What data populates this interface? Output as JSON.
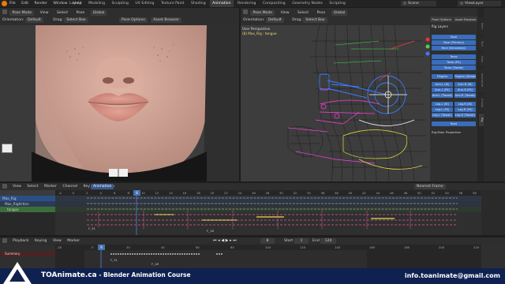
{
  "topbar": {
    "menus": [
      "File",
      "Edit",
      "Render",
      "Window",
      "Help"
    ],
    "workspaces": [
      "Layout",
      "Modeling",
      "Sculpting",
      "UV Editing",
      "Texture Paint",
      "Shading",
      "Animation",
      "Rendering",
      "Compositing",
      "Geometry Nodes",
      "Scripting"
    ],
    "active_workspace": "Animation",
    "scene": "Scene",
    "view_layer": "ViewLayer"
  },
  "left_viewport": {
    "mode": "Pose Mode",
    "view": "View",
    "select": "Select",
    "pose": "Pose",
    "global": "Global",
    "orientation": "Orientation:",
    "default": "Default",
    "drag": "Drag:",
    "select_box": "Select Box",
    "pose_options": "Pose Options",
    "asset_browser": "Asset Browser"
  },
  "right_viewport": {
    "mode": "Pose Mode",
    "view": "View",
    "select": "Select",
    "pose": "Pose",
    "global": "Global",
    "orientation": "Orientation:",
    "default": "Default",
    "drag": "Drag:",
    "select_box": "Select Box",
    "perspective_line1": "User Perspective",
    "perspective_line2": "(8) Max_Rig : tongue",
    "pose_options": "Pose Options",
    "asset_browser": "Asset Browser"
  },
  "rig_panel": {
    "title": "Rig Layers",
    "face": "Face",
    "face_primary": "Face (Primary)",
    "face_secondary": "Face (Secondary)",
    "torso": "Torso",
    "torso_fk": "Torso (FK)",
    "torso_tweak": "Torso (Tweak)",
    "fingers": "Fingers",
    "fingers_detail": "Fingers (Detail)",
    "arm_ik_l": "Arm.L (IK)",
    "arm_ik_r": "Arm.R (IK)",
    "arm_fk_l": "Arm.L (FK)",
    "arm_fk_r": "Arm.R (FK)",
    "arm_tweak_l": "Arm.L (Tweak)",
    "arm_tweak_r": "Arm.R (Tweak)",
    "leg_ik_l": "Leg.L (IK)",
    "leg_ik_r": "Leg.R (IK)",
    "leg_fk_l": "Leg.L (FK)",
    "leg_fk_r": "Leg.R (FK)",
    "leg_tweak_l": "Leg.L (Tweak)",
    "leg_tweak_r": "Leg.R (Tweak)",
    "root": "Root",
    "rig_main_properties": "Rig Main Properties",
    "sidetabs": [
      "Item",
      "Tool",
      "View",
      "Animation",
      "Create",
      "Rig"
    ]
  },
  "dopesheet": {
    "menus": [
      "View",
      "Select",
      "Marker",
      "Channel",
      "Key",
      "Animation"
    ],
    "mode": "Animation",
    "nearest_frame": "Nearest Frame",
    "channels": [
      "Max_Rig",
      "Max_RigAction",
      "tongue"
    ],
    "frames": [
      "-4",
      "0",
      "2",
      "4",
      "6",
      "8",
      "10",
      "12",
      "14",
      "16",
      "18",
      "20",
      "22",
      "24",
      "26",
      "28",
      "30",
      "32",
      "34",
      "36",
      "38",
      "40",
      "42",
      "44",
      "46",
      "48",
      "50",
      "52",
      "54",
      "56",
      "58"
    ],
    "current_frame": "8",
    "marker_f31": "F_31",
    "marker_f18": "F_18"
  },
  "timeline": {
    "menus": [
      "Playback",
      "Keying",
      "View",
      "Marker"
    ],
    "current_frame": "8",
    "start_label": "Start",
    "start": "1",
    "end_label": "End",
    "end": "120",
    "ruler": [
      "-20",
      "0",
      "20",
      "40",
      "60",
      "80",
      "100",
      "120",
      "140",
      "160",
      "180",
      "200",
      "220"
    ],
    "summary_label": "Summary",
    "marker_f31": "F_31",
    "marker_f18": "F_18"
  },
  "banner": {
    "brand": "TOAnimate.ca",
    "course": " - Blender Animation Course",
    "email": "info.toanimate@gmail.com"
  },
  "colors": {
    "accent": "#4772b3",
    "banner": "#0f2150",
    "rig_btn": "#3a6dbb"
  }
}
